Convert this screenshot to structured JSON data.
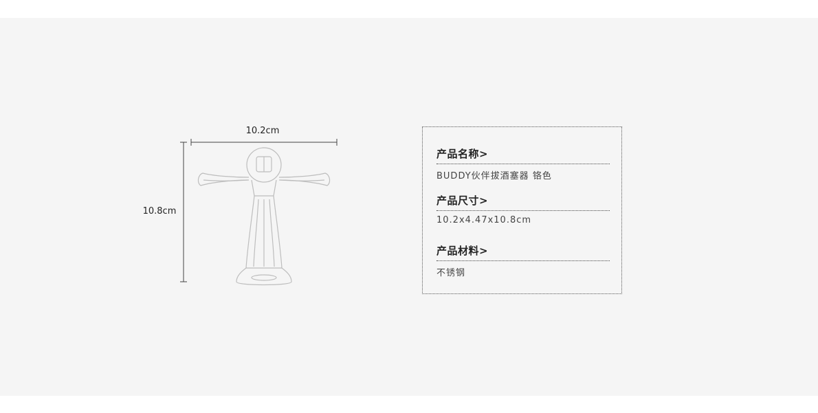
{
  "dimensions": {
    "width_label": "10.2cm",
    "height_label": "10.8cm"
  },
  "info": [
    {
      "title": "产品名称>",
      "value": "BUDDY伙伴拔酒塞器 铬色"
    },
    {
      "title": "产品尺寸>",
      "value": "10.2x4.47x10.8cm"
    },
    {
      "title": "产品材料>",
      "value": "不锈钢"
    }
  ],
  "colors": {
    "panel_background": "#f5f5f5",
    "text": "#222222",
    "product_outline": "#bbbbbb"
  }
}
